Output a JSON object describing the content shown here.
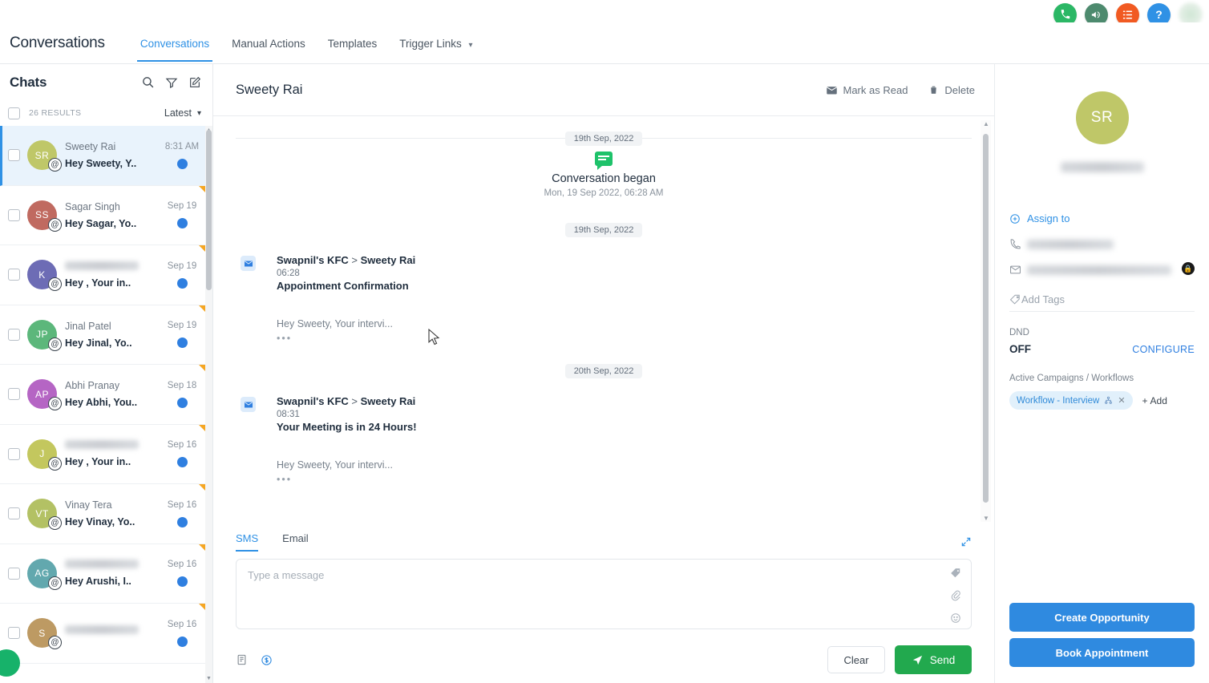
{
  "topbar": {
    "icons": [
      {
        "name": "phone-icon",
        "glyph": "✆",
        "color": "#2bb765"
      },
      {
        "name": "megaphone-icon",
        "glyph": "὎2",
        "color": "#4d8a6e"
      },
      {
        "name": "tasks-icon",
        "glyph": "≡",
        "color": "#f15a22"
      },
      {
        "name": "help-icon",
        "glyph": "?",
        "color": "#2f91e5"
      }
    ]
  },
  "nav": {
    "brand": "Conversations",
    "items": [
      {
        "label": "Conversations",
        "active": true
      },
      {
        "label": "Manual Actions",
        "active": false
      },
      {
        "label": "Templates",
        "active": false
      },
      {
        "label": "Trigger Links",
        "active": false,
        "caret": true
      }
    ]
  },
  "chatlist": {
    "title": "Chats",
    "icons": [
      "search-icon",
      "filter-icon",
      "compose-icon"
    ],
    "results_count": "26 RESULTS",
    "sort_label": "Latest",
    "rows": [
      {
        "initials": "SR",
        "color": "#bfc768",
        "name": "Sweety Rai",
        "name_blurred": false,
        "time": "8:31 AM",
        "preview": "Hey Sweety, Y..",
        "selected": true,
        "flag": false
      },
      {
        "initials": "SS",
        "color": "#c06a60",
        "name": "Sagar Singh",
        "name_blurred": false,
        "time": "Sep 19",
        "preview": "Hey Sagar, Yo..",
        "selected": false,
        "flag": true
      },
      {
        "initials": "K",
        "color": "#6d6cb5",
        "name": "",
        "name_blurred": true,
        "time": "Sep 19",
        "preview": "Hey , Your in..",
        "selected": false,
        "flag": true
      },
      {
        "initials": "JP",
        "color": "#5cb77b",
        "name": "Jinal Patel",
        "name_blurred": false,
        "time": "Sep 19",
        "preview": "Hey Jinal, Yo..",
        "selected": false,
        "flag": true
      },
      {
        "initials": "AP",
        "color": "#b565c4",
        "name": "Abhi Pranay",
        "name_blurred": false,
        "time": "Sep 18",
        "preview": "Hey Abhi, You..",
        "selected": false,
        "flag": true
      },
      {
        "initials": "J",
        "color": "#c3c75e",
        "name": "",
        "name_blurred": true,
        "time": "Sep 16",
        "preview": "Hey , Your in..",
        "selected": false,
        "flag": true
      },
      {
        "initials": "VT",
        "color": "#b3c164",
        "name": "Vinay Tera",
        "name_blurred": false,
        "time": "Sep 16",
        "preview": "Hey Vinay, Yo..",
        "selected": false,
        "flag": true
      },
      {
        "initials": "AG",
        "color": "#62a8ae",
        "name": "",
        "name_blurred": true,
        "time": "Sep 16",
        "preview": "Hey Arushi, I..",
        "selected": false,
        "flag": true
      },
      {
        "initials": "S",
        "color": "#bd9a63",
        "name": "",
        "name_blurred": true,
        "time": "Sep 16",
        "preview": "",
        "selected": false,
        "flag": true
      }
    ]
  },
  "conversation": {
    "contact_name": "Sweety Rai",
    "mark_as_read": "Mark as Read",
    "delete": "Delete",
    "day_separator_1": "19th Sep, 2022",
    "began_title": "Conversation began",
    "began_sub": "Mon, 19 Sep 2022, 06:28 AM",
    "day_separator_2": "19th Sep, 2022",
    "day_separator_3": "20th Sep, 2022",
    "messages": [
      {
        "from": "Swapnil's KFC",
        "arrow": ">",
        "to": "Sweety Rai",
        "time": "06:28",
        "subject": "Appointment Confirmation",
        "text": "Hey Sweety, Your intervi...",
        "dots": "•••"
      },
      {
        "from": "Swapnil's KFC",
        "arrow": ">",
        "to": "Sweety Rai",
        "time": "08:31",
        "subject": "Your Meeting is in 24 Hours!",
        "text": "Hey Sweety, Your intervi...",
        "dots": "•••"
      }
    ]
  },
  "composer": {
    "tabs": [
      {
        "label": "SMS",
        "active": true
      },
      {
        "label": "Email",
        "active": false
      }
    ],
    "placeholder": "Type a message",
    "clear_label": "Clear",
    "send_label": "Send",
    "input_icons": [
      "tag-icon",
      "attachment-icon",
      "emoji-icon"
    ],
    "footer_icons": [
      "template-icon",
      "payment-icon"
    ]
  },
  "contact_panel": {
    "avatar_initials": "SR",
    "avatar_color": "#bfc768",
    "assign_to": "Assign to",
    "tags_placeholder": "Add Tags",
    "dnd_label": "DND",
    "dnd_value": "OFF",
    "configure": "CONFIGURE",
    "campaigns_label": "Active Campaigns / Workflows",
    "workflow_chip": "Workflow - Interview",
    "add_label": "Add",
    "create_opportunity": "Create Opportunity",
    "book_appointment": "Book Appointment"
  }
}
